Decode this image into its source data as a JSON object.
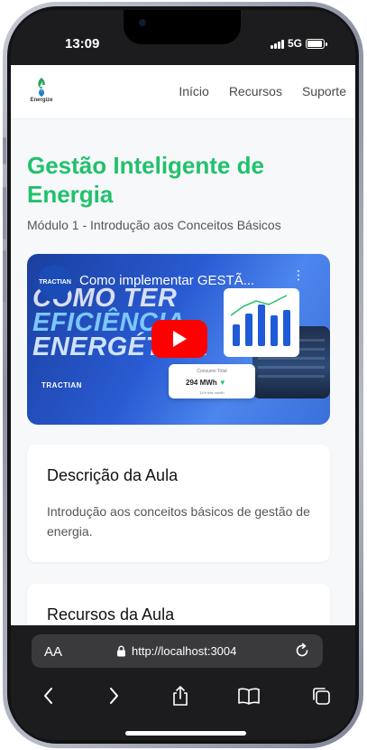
{
  "status_bar": {
    "time": "13:09",
    "network": "5G"
  },
  "site": {
    "logo_text": "Energize",
    "nav": [
      "Início",
      "Recursos",
      "Suporte"
    ]
  },
  "page": {
    "title": "Gestão Inteligente de Energia",
    "module": "Módulo 1 - Introdução aos Conceitos Básicos"
  },
  "video": {
    "title": "Como implementar GESTÃ...",
    "channel": "TRACTIAN",
    "thumbnail_lines": [
      "COMO TER",
      "EFICIÊNCIA",
      "ENERGÉTICA"
    ],
    "thumbnail_brand": "TRACTIAN",
    "stat_label": "Consumo Total",
    "stat_value": "294 MWh",
    "stat_sub": "11% this month"
  },
  "description_card": {
    "title": "Descrição da Aula",
    "text": "Introdução aos conceitos básicos de gestão de energia."
  },
  "resources_card": {
    "title": "Recursos da Aula"
  },
  "browser": {
    "text_size_label": "AA",
    "url": "http://localhost:3004"
  },
  "colors": {
    "accent": "#21c16b",
    "play": "#ff0000",
    "chrome": "#1c1c1e"
  },
  "icons": [
    "lock-icon",
    "reload-icon",
    "back-icon",
    "forward-icon",
    "share-icon",
    "bookmarks-icon",
    "tabs-icon",
    "play-icon"
  ]
}
